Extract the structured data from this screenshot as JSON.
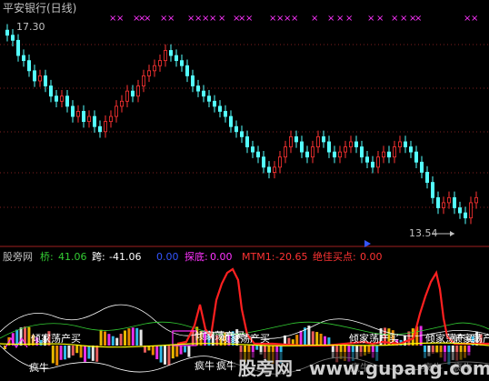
{
  "header": {
    "title": "平安银行(日线)",
    "title_color": "#c0c0c0",
    "max_price_label": "17.30",
    "min_price_label": "13.54",
    "min_arrow": "←"
  },
  "indicator_bar": {
    "panel_name": "股旁网",
    "items": [
      {
        "label": "桥:",
        "value": "41.06",
        "color": "#33cc33"
      },
      {
        "label": "跨:",
        "value": "-41.06",
        "color": "#ffffff"
      },
      {
        "label": "",
        "value": "0.00",
        "color": "#3355ff"
      },
      {
        "label": "探底:",
        "value": "0.00",
        "color": "#ff33ff"
      },
      {
        "label": "MTM1:",
        "value": "-20.65",
        "color": "#ff3333"
      },
      {
        "label": "绝佳买点:",
        "value": "0.00",
        "color": "#ff3333"
      }
    ]
  },
  "annotations": {
    "gujiadang_label": "倾家荡产买",
    "fengniu_label": "疯牛"
  },
  "watermark": {
    "brand": "股旁网",
    "url": "www.gupang.com"
  },
  "colors": {
    "up_candle": "#ff3333",
    "down_candle": "#54ffff",
    "grid": "#802020",
    "panel_border": "#802020",
    "mtm_line": "#ff2020",
    "envelope": "#ffffff",
    "yellow_band": "#ffff00",
    "cross_marks": "#ff33ff"
  },
  "chart_data": {
    "type": "candlestick",
    "y_range": [
      13.2,
      17.5
    ],
    "max_price": 17.3,
    "min_price": 13.54,
    "closes": [
      17.2,
      17.1,
      16.8,
      16.7,
      16.5,
      16.3,
      16.4,
      16.2,
      16.0,
      15.9,
      16.0,
      15.8,
      15.6,
      15.7,
      15.5,
      15.6,
      15.4,
      15.3,
      15.5,
      15.6,
      15.8,
      15.9,
      16.1,
      16.0,
      16.2,
      16.4,
      16.5,
      16.6,
      16.7,
      16.9,
      16.8,
      16.7,
      16.6,
      16.4,
      16.2,
      16.1,
      16.0,
      15.9,
      15.8,
      15.7,
      15.6,
      15.4,
      15.3,
      15.2,
      15.0,
      14.9,
      14.8,
      14.6,
      14.5,
      14.6,
      14.8,
      15.0,
      15.2,
      15.1,
      14.9,
      14.8,
      15.0,
      15.2,
      15.1,
      14.9,
      14.8,
      14.9,
      15.0,
      15.1,
      15.0,
      14.8,
      14.7,
      14.6,
      14.8,
      14.9,
      14.8,
      15.0,
      15.1,
      15.0,
      14.9,
      14.7,
      14.5,
      14.3,
      14.0,
      13.8,
      13.9,
      14.0,
      13.8,
      13.7,
      13.6,
      13.9,
      14.0
    ]
  }
}
